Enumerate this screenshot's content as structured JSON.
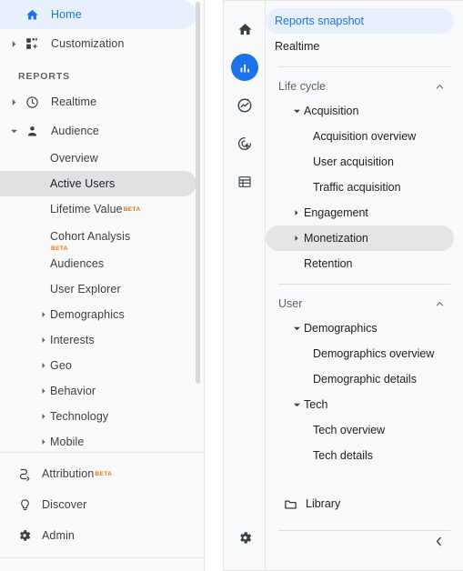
{
  "left_panel": {
    "top_items": [
      {
        "label": "Home",
        "icon": "home-icon",
        "selected": true,
        "caret": "none"
      },
      {
        "label": "Customization",
        "icon": "customization-icon",
        "selected": false,
        "caret": "right"
      }
    ],
    "section_label": "REPORTS",
    "reports_items": [
      {
        "label": "Realtime",
        "icon": "clock-icon",
        "caret": "right"
      },
      {
        "label": "Audience",
        "icon": "person-icon",
        "caret": "down"
      }
    ],
    "audience_children": [
      {
        "label": "Overview",
        "caret": "none",
        "selected": false,
        "badge": ""
      },
      {
        "label": "Active Users",
        "caret": "none",
        "selected": true,
        "badge": ""
      },
      {
        "label": "Lifetime Value",
        "caret": "none",
        "selected": false,
        "badge": "BETA",
        "badge_pos": "super"
      },
      {
        "label": "Cohort Analysis",
        "caret": "none",
        "selected": false,
        "badge": "BETA",
        "badge_pos": "below"
      },
      {
        "label": "Audiences",
        "caret": "none",
        "selected": false,
        "badge": ""
      },
      {
        "label": "User Explorer",
        "caret": "none",
        "selected": false,
        "badge": ""
      },
      {
        "label": "Demographics",
        "caret": "right",
        "selected": false,
        "badge": ""
      },
      {
        "label": "Interests",
        "caret": "right",
        "selected": false,
        "badge": ""
      },
      {
        "label": "Geo",
        "caret": "right",
        "selected": false,
        "badge": ""
      },
      {
        "label": "Behavior",
        "caret": "right",
        "selected": false,
        "badge": ""
      },
      {
        "label": "Technology",
        "caret": "right",
        "selected": false,
        "badge": ""
      },
      {
        "label": "Mobile",
        "caret": "right",
        "selected": false,
        "badge": ""
      }
    ],
    "bottom_items": [
      {
        "label": "Attribution",
        "icon": "attribution-icon",
        "badge": "BETA"
      },
      {
        "label": "Discover",
        "icon": "bulb-icon",
        "badge": ""
      },
      {
        "label": "Admin",
        "icon": "gear-icon",
        "badge": ""
      }
    ]
  },
  "right_panel": {
    "rail": [
      {
        "name": "home-icon",
        "active": false
      },
      {
        "name": "reports-bar-chart-icon",
        "active": true
      },
      {
        "name": "explore-icon",
        "active": false
      },
      {
        "name": "advertising-icon",
        "active": false
      },
      {
        "name": "configure-table-icon",
        "active": false
      }
    ],
    "rail_footer": {
      "name": "gear-icon"
    },
    "top_items": [
      {
        "label": "Reports snapshot",
        "selected": true
      },
      {
        "label": "Realtime",
        "selected": false
      }
    ],
    "sections": [
      {
        "title": "Life cycle",
        "chevron": "up",
        "items": [
          {
            "label": "Acquisition",
            "level": 2,
            "caret": "down",
            "state": "normal"
          },
          {
            "label": "Acquisition overview",
            "level": 3,
            "caret": "none",
            "state": "normal"
          },
          {
            "label": "User acquisition",
            "level": 3,
            "caret": "none",
            "state": "normal"
          },
          {
            "label": "Traffic acquisition",
            "level": 3,
            "caret": "none",
            "state": "normal"
          },
          {
            "label": "Engagement",
            "level": 2,
            "caret": "right",
            "state": "normal"
          },
          {
            "label": "Monetization",
            "level": 2,
            "caret": "right",
            "state": "hovered"
          },
          {
            "label": "Retention",
            "level": 2,
            "caret": "none",
            "state": "normal"
          }
        ]
      },
      {
        "title": "User",
        "chevron": "up",
        "items": [
          {
            "label": "Demographics",
            "level": 2,
            "caret": "down",
            "state": "normal"
          },
          {
            "label": "Demographics overview",
            "level": 3,
            "caret": "none",
            "state": "normal"
          },
          {
            "label": "Demographic details",
            "level": 3,
            "caret": "none",
            "state": "normal"
          },
          {
            "label": "Tech",
            "level": 2,
            "caret": "down",
            "state": "normal"
          },
          {
            "label": "Tech overview",
            "level": 3,
            "caret": "none",
            "state": "normal"
          },
          {
            "label": "Tech details",
            "level": 3,
            "caret": "none",
            "state": "normal"
          }
        ]
      }
    ],
    "library": {
      "label": "Library",
      "icon": "folder-icon"
    },
    "collapse": {
      "icon": "chevron-left-icon"
    }
  },
  "colors": {
    "accent_blue": "#1a73e8",
    "selected_blue_bg": "#e8f0fe",
    "hover_gray_bg": "#dfe1e3",
    "beta_orange": "#e8710a",
    "panel_bg": "#f8f9fa",
    "left_panel_bg": "#fafafa",
    "text_primary": "#3c4043",
    "text_secondary": "#5f6368"
  }
}
